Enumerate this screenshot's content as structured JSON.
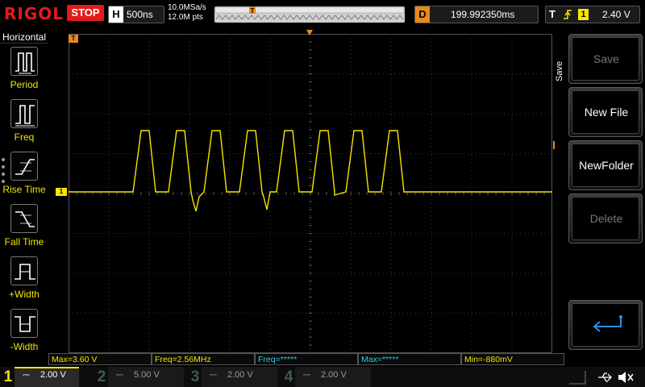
{
  "header": {
    "brand": "RIGOL",
    "run_state": "STOP",
    "horizontal": {
      "letter": "H",
      "timebase": "500ns"
    },
    "sample_rate": "10.0MSa/s",
    "memory_depth": "12.0M pts",
    "delay": {
      "letter": "D",
      "value": "199.992350ms"
    },
    "trigger": {
      "letter": "T",
      "source": "1",
      "level": "2.40 V"
    }
  },
  "left_panel": {
    "title": "Horizontal",
    "items": [
      {
        "label": "Period",
        "icon": "period-icon"
      },
      {
        "label": "Freq",
        "icon": "frequency-icon"
      },
      {
        "label": "Rise Time",
        "icon": "rise-time-icon"
      },
      {
        "label": "Fall Time",
        "icon": "fall-time-icon"
      },
      {
        "label": "+Width",
        "icon": "positive-width-icon"
      },
      {
        "label": "-Width",
        "icon": "negative-width-icon"
      }
    ]
  },
  "scope": {
    "trigger_marker": "T",
    "ch1_marker": "1",
    "colors": {
      "ch1": "#f5e400",
      "grid": "#3a3a3a",
      "marker": "#e8891a"
    }
  },
  "right_menu": {
    "title": "Save",
    "items": [
      {
        "label": "Save",
        "enabled": false
      },
      {
        "label": "New File",
        "enabled": true
      },
      {
        "label": "NewFolder",
        "enabled": true
      },
      {
        "label": "Delete",
        "enabled": false
      },
      {
        "label": "",
        "icon": "return-icon",
        "enabled": true
      }
    ]
  },
  "measurements": [
    {
      "text": "Max=3.60 V"
    },
    {
      "text": "Freq=2.56MHz"
    },
    {
      "text": "Freq=*****"
    },
    {
      "text": "Max=*****"
    },
    {
      "text": "Min=-880mV"
    }
  ],
  "channels": [
    {
      "number": "1",
      "scale": "2.00 V",
      "active": true
    },
    {
      "number": "2",
      "scale": "5.00 V",
      "active": false
    },
    {
      "number": "3",
      "scale": "2.00 V",
      "active": false
    },
    {
      "number": "4",
      "scale": "2.00 V",
      "active": false
    }
  ],
  "status_icons": [
    "usb-icon",
    "speaker-muted-icon"
  ]
}
